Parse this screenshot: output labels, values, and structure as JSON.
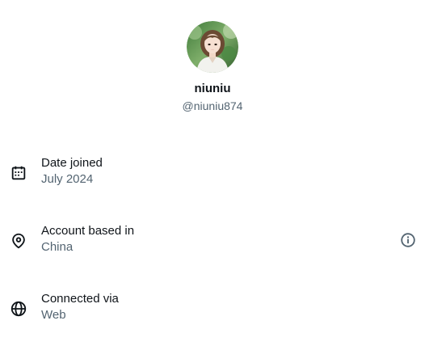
{
  "profile": {
    "display_name": "niuniu",
    "handle": "@niuniu874"
  },
  "rows": [
    {
      "icon": "calendar-icon",
      "label": "Date joined",
      "value": "July 2024"
    },
    {
      "icon": "location-pin-icon",
      "label": "Account based in",
      "value": "China",
      "action_icon": "info-icon"
    },
    {
      "icon": "globe-icon",
      "label": "Connected via",
      "value": "Web"
    }
  ],
  "colors": {
    "primary_text": "#0f1419",
    "secondary_text": "#536471",
    "background": "#ffffff"
  }
}
